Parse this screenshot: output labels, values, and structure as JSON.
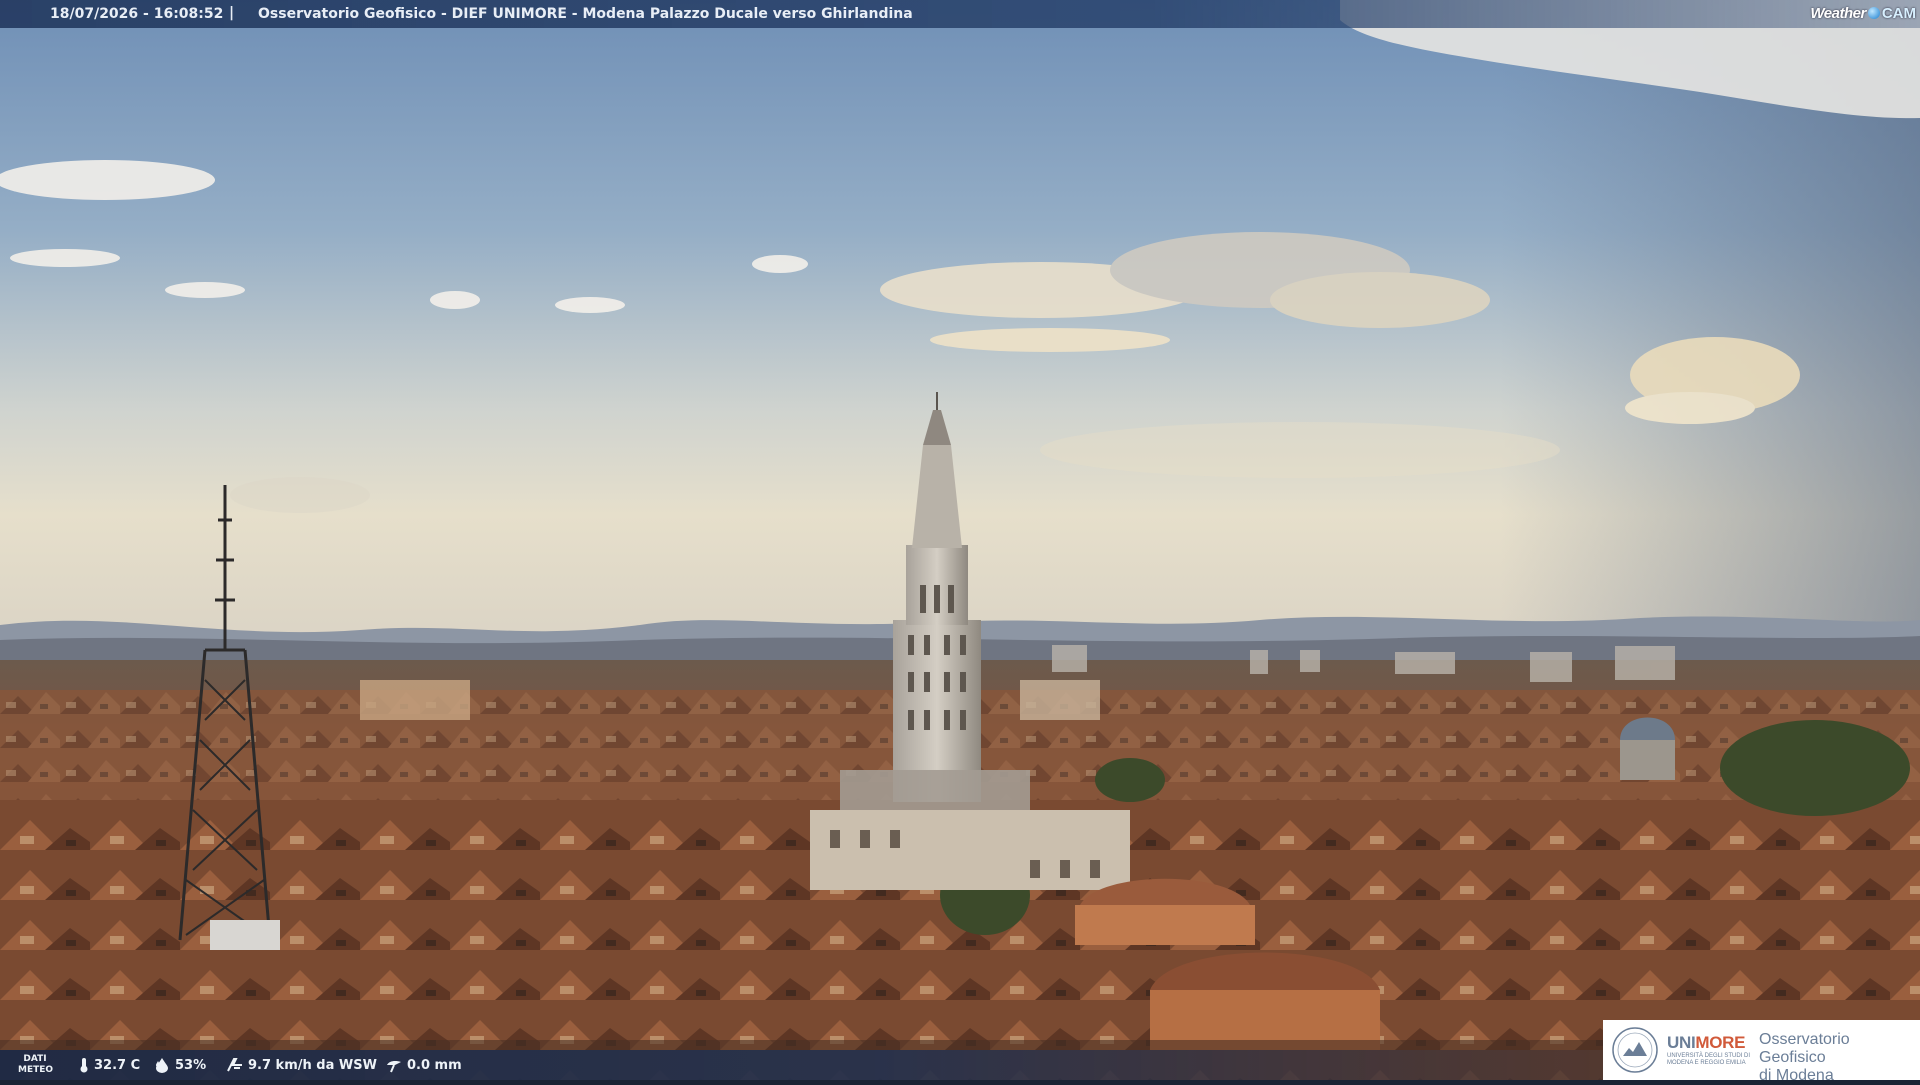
{
  "overlay": {
    "timestamp": "18/07/2026 - 16:08:52",
    "separator": "|",
    "title": "Osservatorio Geofisico - DIEF UNIMORE - Modena Palazzo Ducale verso Ghirlandina",
    "brand_weather": "Weather",
    "brand_cam": "CAM"
  },
  "weather": {
    "label_line1": "DATI",
    "label_line2": "METEO",
    "temperature": "32.7 C",
    "humidity": "53%",
    "wind": "9.7 km/h da WSW",
    "rain": "0.0 mm",
    "icons": [
      "thermometer-icon",
      "humidity-drop-icon",
      "wind-icon",
      "rain-gauge-icon"
    ]
  },
  "logo": {
    "unimore_part1": "UNI",
    "unimore_part2": "MORE",
    "unimore_sub": "UNIVERSITÀ DEGLI STUDI DI MODENA E REGGIO EMILIA",
    "observatory_line1": "Osservatorio Geofisico",
    "observatory_line2": "di Modena"
  },
  "colors": {
    "sky_top": "#6f8fb6",
    "sky_horizon": "#e4ddc8",
    "roofs": "#8b5a3c",
    "overlay_bar": "#243a60"
  }
}
